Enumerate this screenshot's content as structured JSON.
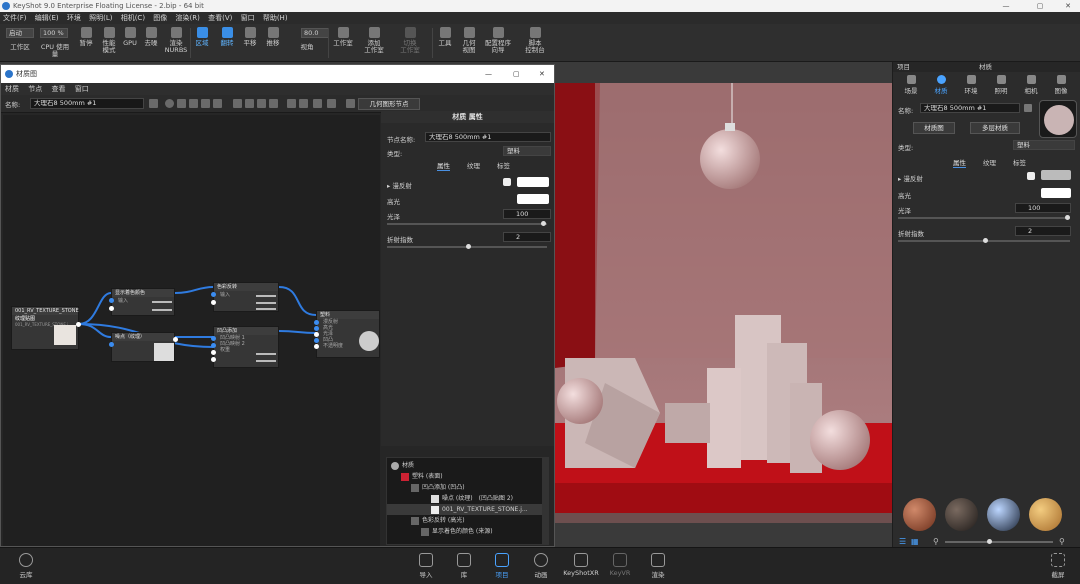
{
  "app": {
    "title": "KeyShot 9.0 Enterprise Floating License  -  2.bip  -  64 bit",
    "menu": [
      "文件(F)",
      "编辑(E)",
      "环境",
      "照明(L)",
      "相机(C)",
      "图像",
      "渲染(R)",
      "查看(V)",
      "窗口",
      "帮助(H)"
    ]
  },
  "toolbar": {
    "workspace_select": "启动",
    "percent_select": "100 %",
    "zoom_value": "80.0",
    "items": [
      {
        "label": "工作区"
      },
      {
        "label": "CPU 使用量"
      },
      {
        "label": "暂停"
      },
      {
        "label": "性能\n模式"
      },
      {
        "label": "GPU"
      },
      {
        "label": "去噪"
      },
      {
        "label": "渲染\nNURBS"
      },
      {
        "label": "区域"
      },
      {
        "label": "翻转"
      },
      {
        "label": "平移"
      },
      {
        "label": "推移"
      },
      {
        "label": "视角"
      },
      {
        "label": "工作室"
      },
      {
        "label": "添加\n工作室"
      },
      {
        "label": "切换\n工作室"
      },
      {
        "label": "工具"
      },
      {
        "label": "几何\n视图"
      },
      {
        "label": "配置程序\n向导"
      },
      {
        "label": "脚本\n控制台"
      }
    ]
  },
  "material_window": {
    "title": "材质图",
    "menu": [
      "材质",
      "节点",
      "查看",
      "窗口"
    ],
    "name_label": "名称:",
    "name_value": "大理石8 500mm #1",
    "geo_button": "几何图形节点",
    "nodes": {
      "texture": {
        "title": "001_RV_TEXTURE_STONE",
        "sub": "纹理贴图",
        "line": "001_RV_TEXTURE_STONE.j"
      },
      "color_display": {
        "title": "显示着色颜色",
        "port": "输入"
      },
      "color_adjust": {
        "title": "色彩反转",
        "port": "输入"
      },
      "noise": {
        "title": "噪点（纹理）"
      },
      "bump_add": {
        "title": "凹凸添加",
        "ports": [
          "凹凸映射 1",
          "凹凸映射 2",
          "权重",
          "权重"
        ]
      },
      "material": {
        "title": "塑料",
        "ports": [
          "漫反射",
          "高光",
          "光泽",
          "凹凸",
          "不透明度"
        ]
      }
    }
  },
  "material_props": {
    "header": "材质 属性",
    "node_name_label": "节点名称:",
    "node_name": "大理石8 500mm #1",
    "type_label": "类型:",
    "type_value": "塑料",
    "tabs": [
      "属性",
      "纹理",
      "标签"
    ],
    "diffuse": "漫反射",
    "specular": "高光",
    "roughness": "光泽",
    "roughness_value": "100",
    "ior_label": "折射指数",
    "ior_value": "2"
  },
  "tree": {
    "rows": [
      "材质",
      "塑料 (表面)",
      "凹凸添加 (凹凸)",
      "噪点 (纹理)　(凹凸贴图 2)",
      "001_RV_TEXTURE_STONE.j...",
      "色彩反转 (高光)",
      "显示着色的颜色 (来源)"
    ]
  },
  "right_panel": {
    "title_left": "项目",
    "title_center": "材质",
    "tabs": [
      "场景",
      "材质",
      "环境",
      "照明",
      "相机",
      "图像"
    ],
    "name_label": "名称:",
    "name_value": "大理石8 500mm #1",
    "btn_graph": "材质图",
    "btn_multi": "多层材质",
    "type_label": "类型:",
    "type_value": "塑料",
    "subtabs": [
      "属性",
      "纹理",
      "标签"
    ],
    "diffuse": "漫反射",
    "specular": "高光",
    "roughness": "光泽",
    "roughness_value": "100",
    "ior_label": "折射指数",
    "ior_value": "2"
  },
  "bottom": {
    "library": "云库",
    "items": [
      "导入",
      "库",
      "项目",
      "动画",
      "KeyShotXR",
      "KeyVR",
      "渲染"
    ],
    "screenshot": "截屏"
  }
}
